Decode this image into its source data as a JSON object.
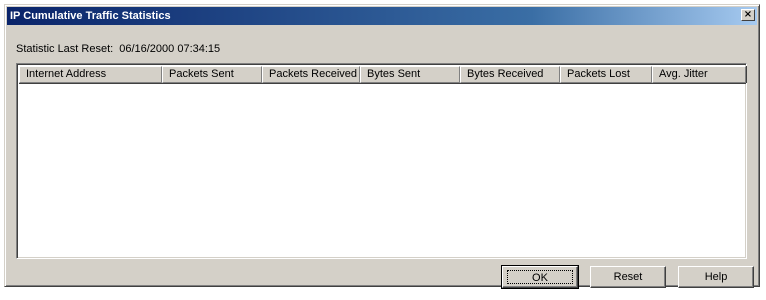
{
  "window": {
    "title": "IP Cumulative Traffic Statistics",
    "close_label": "×"
  },
  "stats": {
    "reset_label": "Statistic Last Reset:",
    "reset_value": "06/16/2000 07:34:15"
  },
  "table": {
    "columns": [
      "Internet Address",
      "Packets Sent",
      "Packets Received",
      "Bytes Sent",
      "Bytes Received",
      "Packets Lost",
      "Avg. Jitter"
    ],
    "rows": []
  },
  "buttons": {
    "ok": "OK",
    "reset": "Reset",
    "help": "Help"
  }
}
